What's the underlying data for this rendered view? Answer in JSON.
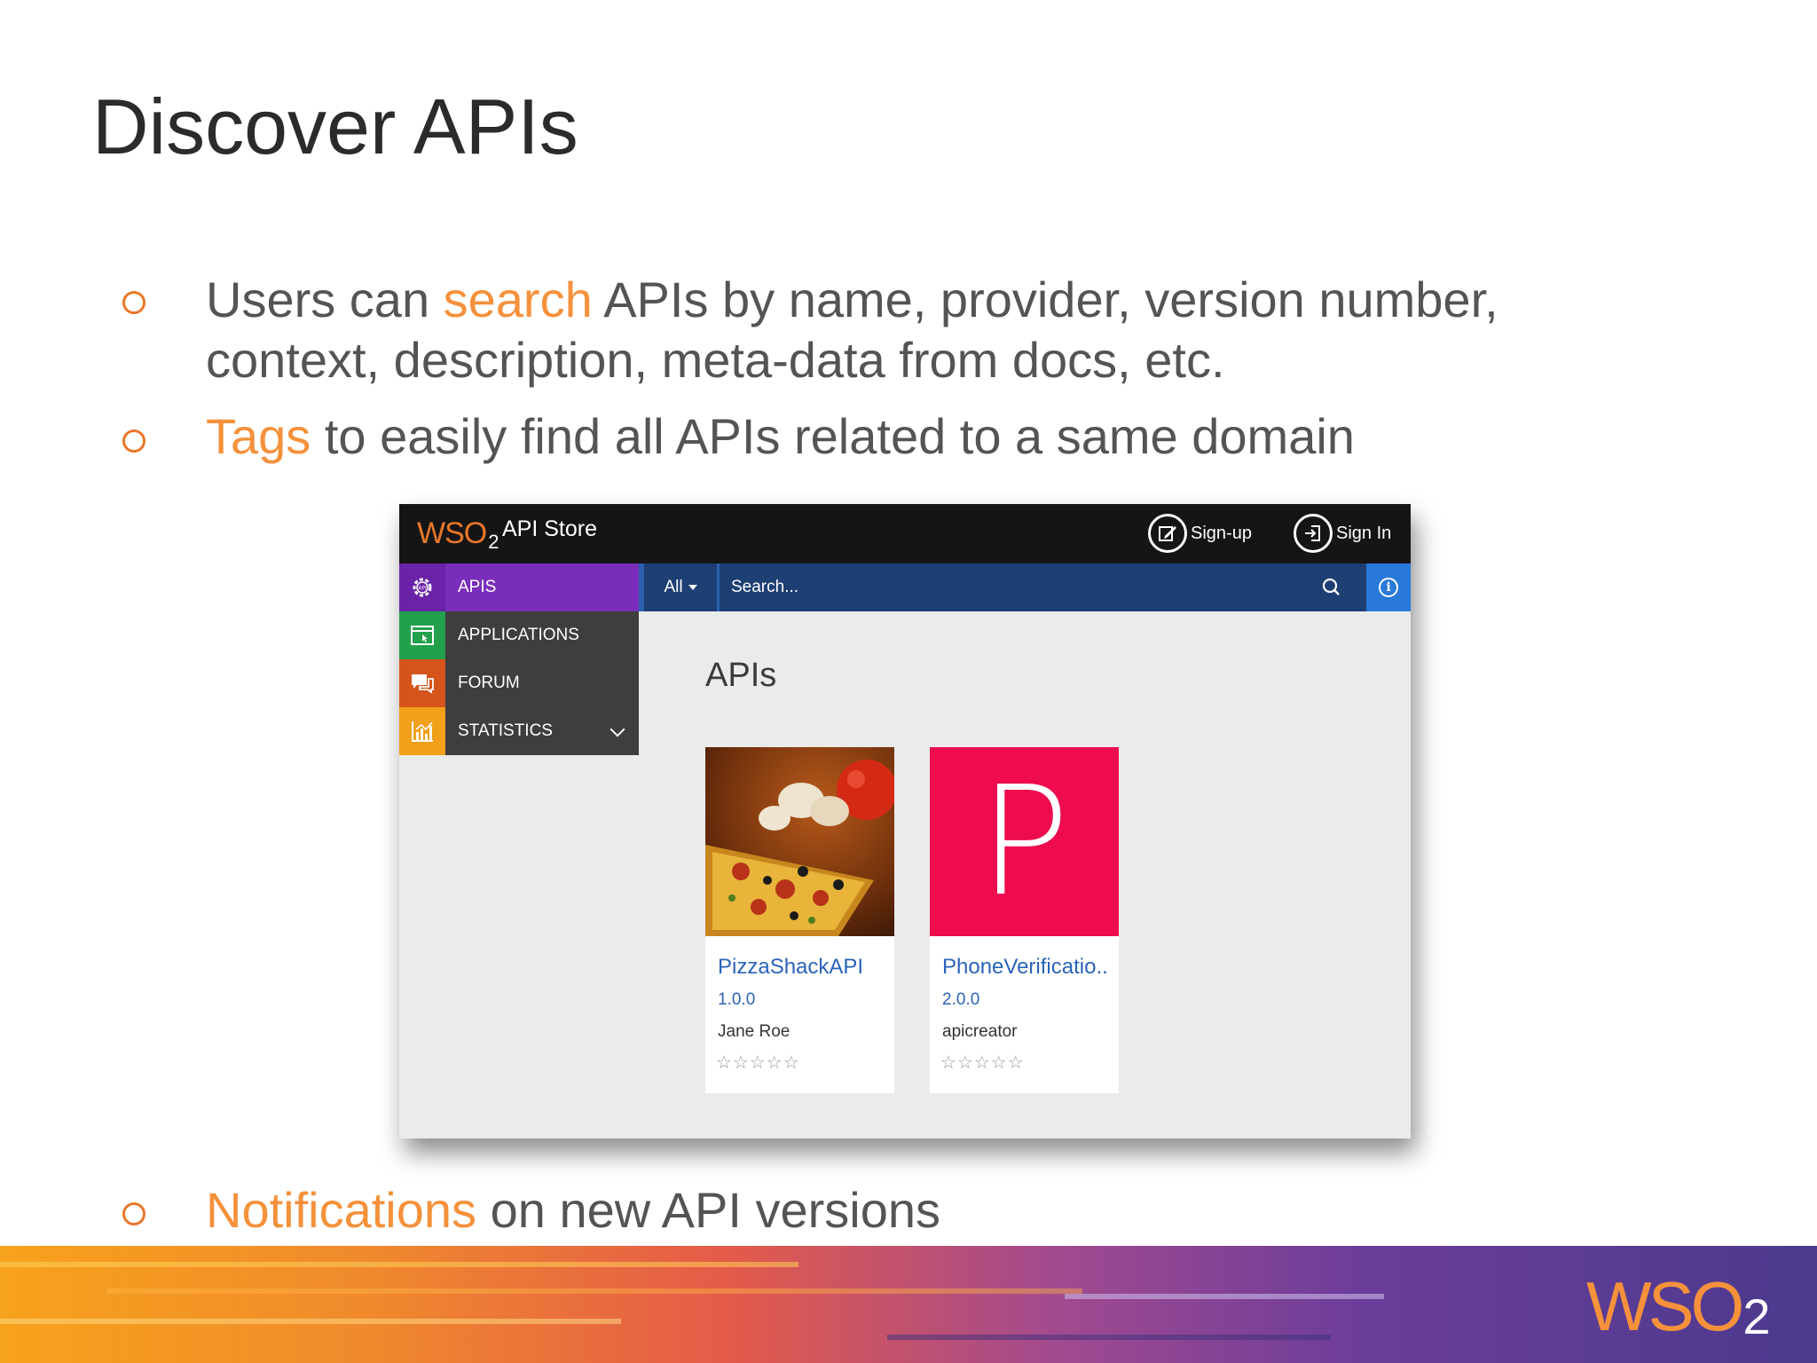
{
  "slide": {
    "title": "Discover APIs",
    "bullets": [
      {
        "highlight": "search",
        "before": "Users can ",
        "after": " APIs by name, provider, version number, context, description, meta-data from docs, etc."
      },
      {
        "highlight": "Tags",
        "before": "",
        "after": " to easily find all APIs related to a same domain"
      },
      {
        "highlight": "Notifications",
        "before": "",
        "after": " on new API versions"
      }
    ],
    "highlight_color": "#f5913b",
    "footer_logo": {
      "text": "WSO",
      "sub": "2"
    }
  },
  "store": {
    "logo": {
      "text": "WSO",
      "sub": "2"
    },
    "title": "API Store",
    "signup_label": "Sign-up",
    "signin_label": "Sign In",
    "search": {
      "scope": "All",
      "placeholder": "Search..."
    },
    "sidebar": {
      "items": [
        {
          "label": "APIS",
          "icon": "gear-api-icon",
          "color": "#7a2dbb"
        },
        {
          "label": "APPLICATIONS",
          "icon": "window-cursor-icon",
          "color": "#22a04b"
        },
        {
          "label": "FORUM",
          "icon": "chat-bubbles-icon",
          "color": "#d4541c"
        },
        {
          "label": "STATISTICS",
          "icon": "bar-chart-icon",
          "color": "#f0a019"
        }
      ]
    },
    "section_title": "APIs",
    "apis": [
      {
        "name": "PizzaShackAPI",
        "version": "1.0.0",
        "provider": "Jane Roe",
        "rating": "☆☆☆☆☆",
        "thumb": "pizza-image"
      },
      {
        "name": "PhoneVerificatio..",
        "version": "2.0.0",
        "provider": "apicreator",
        "rating": "☆☆☆☆☆",
        "thumb_letter": "P",
        "thumb_color": "#ee0c4f"
      }
    ]
  }
}
